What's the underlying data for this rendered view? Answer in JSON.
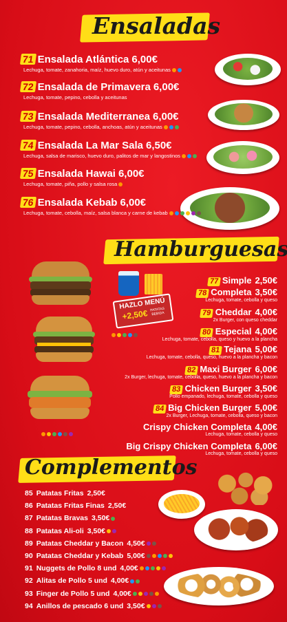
{
  "ensaladas": {
    "title": "Ensaladas",
    "items": [
      {
        "num": "71",
        "name": "Ensalada Atlántica",
        "price": "6,00€",
        "desc": "Lechuga, tomate, zanahoria, maíz, huevo duro, atún y aceitunas"
      },
      {
        "num": "72",
        "name": "Ensalada de Primavera",
        "price": "6,00€",
        "desc": "Lechuga, tomate, pepino, cebolla y aceitunas"
      },
      {
        "num": "73",
        "name": "Ensalada Mediterranea",
        "price": "6,00€",
        "desc": "Lechuga, tomate, pepino, cebolla, anchoas, atún y aceitunas"
      },
      {
        "num": "74",
        "name": "Ensalada La Mar Sala",
        "price": "6,50€",
        "desc": "Lechuga, salsa de marisco, huevo duro, palitos de mar y langostinos"
      },
      {
        "num": "75",
        "name": "Ensalada Hawai",
        "price": "6,00€",
        "desc": "Lechuga, tomate, piña, pollo y salsa rosa"
      },
      {
        "num": "76",
        "name": "Ensalada Kebab",
        "price": "6,00€",
        "desc": "Lechuga, tomate, cebolla, maíz, salsa blanca y carne de kebab"
      }
    ]
  },
  "hamburguesas": {
    "title": "Hamburguesas",
    "promo": {
      "line1": "HAZLO MENÚ",
      "line2": "+2,50€",
      "line3": "PATATAS",
      "line4": "BEBIDA"
    },
    "items": [
      {
        "num": "77",
        "name": "Simple",
        "price": "2,50€",
        "desc": ""
      },
      {
        "num": "78",
        "name": "Completa",
        "price": "3,50€",
        "desc": "Lechuga, tomate, cebolla y queso"
      },
      {
        "num": "79",
        "name": "Cheddar",
        "price": "4,00€",
        "desc": "2x Burger, con queso cheddar"
      },
      {
        "num": "80",
        "name": "Especial",
        "price": "4,00€",
        "desc": "Lechuga, tomate, cebolla, queso y huevo a la plancha"
      },
      {
        "num": "81",
        "name": "Tejana",
        "price": "5,00€",
        "desc": "Lechuga, tomate, cebolla, queso, huevo a la plancha y bacon"
      },
      {
        "num": "82",
        "name": "Maxi Burger",
        "price": "6,00€",
        "desc": "2x Burger, lechuga, tomate, cebolla, queso, huevo a la plancha y bacon"
      },
      {
        "num": "83",
        "name": "Chicken Burger",
        "price": "3,50€",
        "desc": "Pollo empanado, lechuga, tomate, cebolla y queso"
      },
      {
        "num": "84",
        "name": "Big Chicken Burger",
        "price": "5,00€",
        "desc": "2x Burger, Lechuga, tomate, cebolla, queso y bacon"
      },
      {
        "num": "",
        "name": "Crispy Chicken Completa",
        "price": "4,00€",
        "desc": "Lechuga, tomate, cebolla y queso"
      },
      {
        "num": "",
        "name": "Big Crispy Chicken Completa",
        "price": "6,00€",
        "desc": "Lechuga, tomate, cebolla y queso"
      }
    ]
  },
  "complementos": {
    "title": "Complementos",
    "items": [
      {
        "num": "85",
        "name": "Patatas Fritas",
        "price": "2,50€"
      },
      {
        "num": "86",
        "name": "Patatas Fritas Finas",
        "price": "2,50€"
      },
      {
        "num": "87",
        "name": "Patatas Bravas",
        "price": "3,50€"
      },
      {
        "num": "88",
        "name": "Patatas Ali-oli",
        "price": "3,50€"
      },
      {
        "num": "89",
        "name": "Patatas Cheddar y Bacon",
        "price": "4,50€"
      },
      {
        "num": "90",
        "name": "Patatas Cheddar y Kebab",
        "price": "5,00€"
      },
      {
        "num": "91",
        "name": "Nuggets de Pollo 8 und",
        "price": "4,00€"
      },
      {
        "num": "92",
        "name": "Alitas de Pollo 5 und",
        "price": "4,00€"
      },
      {
        "num": "93",
        "name": "Finger de Pollo 5 und",
        "price": "4,00€"
      },
      {
        "num": "94",
        "name": "Anillos de pescado 6 und",
        "price": "3,50€"
      }
    ]
  },
  "colors": {
    "background": "#e30613",
    "banner": "#ffde17",
    "text": "#ffffff"
  }
}
